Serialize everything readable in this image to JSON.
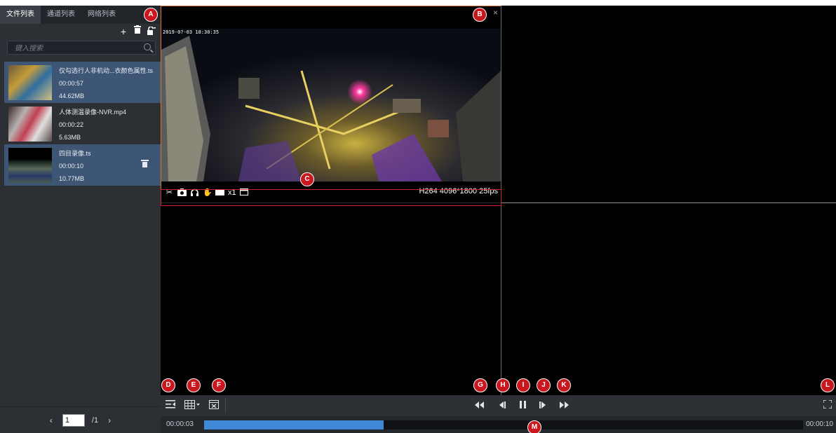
{
  "sidebar": {
    "tabs": [
      "文件列表",
      "通道列表",
      "网络列表"
    ],
    "active_tab": 0,
    "tools": {
      "add_icon": "plus-icon",
      "delete_icon": "trash-icon",
      "lock_icon": "lock-icon"
    },
    "search": {
      "placeholder": "键入搜索",
      "value": ""
    },
    "files": [
      {
        "name": "仅勾选行人非机动...衣颜色属性.ts",
        "duration": "00:00:57",
        "size": "44.62MB",
        "selected": true
      },
      {
        "name": "人体测温录像-NVR.mp4",
        "duration": "00:00:22",
        "size": "5.63MB",
        "selected": false
      },
      {
        "name": "四目录像.ts",
        "duration": "00:00:10",
        "size": "10.77MB",
        "selected": true
      }
    ],
    "pager": {
      "prev": "‹",
      "next": "›",
      "current": "1",
      "total": "/1"
    }
  },
  "player": {
    "pane1": {
      "osd": "2019-0?-03 18:30:35",
      "close": "×",
      "toolbar_icons": [
        "scissors-icon",
        "camera-icon",
        "audio-icon",
        "hand-icon",
        "folder-icon"
      ],
      "speed": "x1",
      "window_icon": "window-icon",
      "codec_info": "H264 4096*1800 25fps"
    }
  },
  "markers": [
    "A",
    "B",
    "C",
    "D",
    "E",
    "F",
    "G",
    "H",
    "I",
    "J",
    "K",
    "L",
    "M"
  ],
  "controls": {
    "left": [
      "playlist-icon",
      "layout-grid-icon",
      "close-all-icon"
    ],
    "center": [
      "rewind-icon",
      "step-back-icon",
      "pause-icon",
      "step-forward-icon",
      "fast-forward-icon"
    ],
    "right": [
      "fullscreen-icon"
    ]
  },
  "timeline": {
    "current": "00:00:03",
    "end": "00:00:10",
    "progress": 0.3
  },
  "colors": {
    "accent": "#3f88d8",
    "selected_row": "#3d5675",
    "marker": "#c8181e",
    "pane_border": "#d27a3c"
  }
}
